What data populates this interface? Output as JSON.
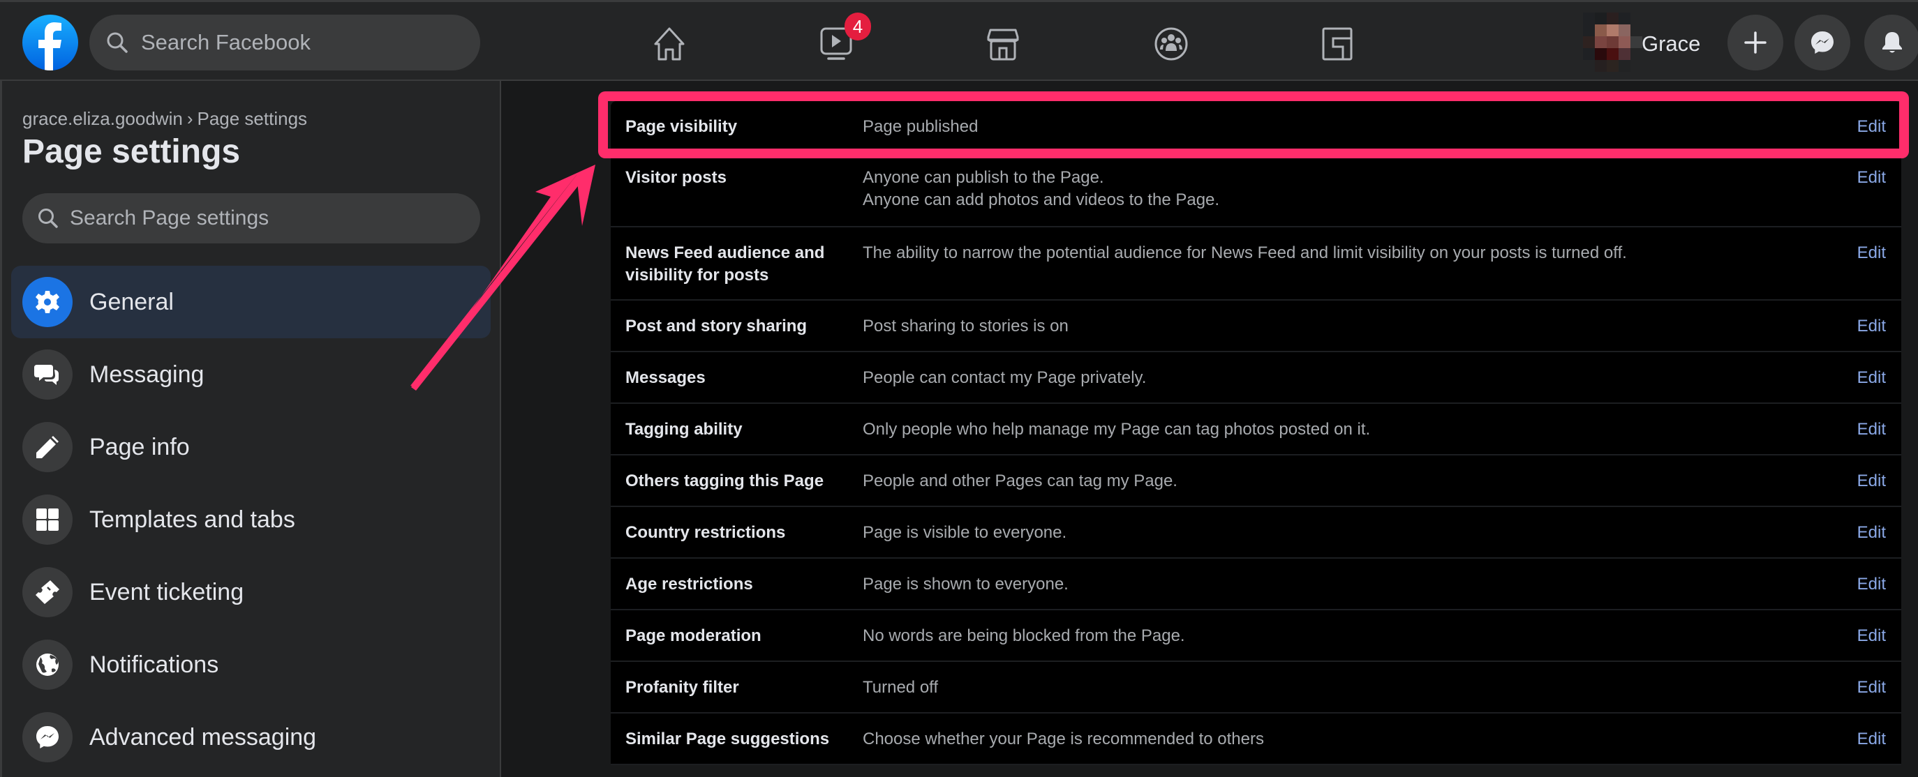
{
  "header": {
    "search_placeholder": "Search Facebook",
    "nav": [
      {
        "name": "home",
        "icon": "home-icon"
      },
      {
        "name": "watch",
        "icon": "video-icon",
        "badge": "4"
      },
      {
        "name": "marketplace",
        "icon": "marketplace-icon"
      },
      {
        "name": "groups",
        "icon": "groups-icon"
      },
      {
        "name": "gaming",
        "icon": "gaming-icon"
      }
    ],
    "user_name": "Grace",
    "actions": [
      {
        "name": "create",
        "icon": "plus-icon"
      },
      {
        "name": "messenger",
        "icon": "messenger-icon"
      },
      {
        "name": "notifications",
        "icon": "bell-icon"
      }
    ]
  },
  "sidebar": {
    "breadcrumb": {
      "parent": "grace.eliza.goodwin",
      "separator": "›",
      "current": "Page settings"
    },
    "title": "Page settings",
    "search_placeholder": "Search Page settings",
    "items": [
      {
        "label": "General",
        "icon": "gear-icon",
        "active": true
      },
      {
        "label": "Messaging",
        "icon": "chat-bubbles-icon"
      },
      {
        "label": "Page info",
        "icon": "pencil-icon"
      },
      {
        "label": "Templates and tabs",
        "icon": "grid-icon"
      },
      {
        "label": "Event ticketing",
        "icon": "ticket-icon"
      },
      {
        "label": "Notifications",
        "icon": "globe-icon"
      },
      {
        "label": "Advanced messaging",
        "icon": "messenger-icon"
      }
    ]
  },
  "settings": {
    "edit_label": "Edit",
    "rows": [
      {
        "label": "Page visibility",
        "desc": [
          "Page published"
        ]
      },
      {
        "label": "Visitor posts",
        "desc": [
          "Anyone can publish to the Page.",
          "Anyone can add photos and videos to the Page."
        ]
      },
      {
        "label": "News Feed audience and visibility for posts",
        "desc": [
          "The ability to narrow the potential audience for News Feed and limit visibility on your posts is turned off."
        ]
      },
      {
        "label": "Post and story sharing",
        "desc": [
          "Post sharing to stories is on"
        ]
      },
      {
        "label": "Messages",
        "desc": [
          "People can contact my Page privately."
        ]
      },
      {
        "label": "Tagging ability",
        "desc": [
          "Only people who help manage my Page can tag photos posted on it."
        ]
      },
      {
        "label": "Others tagging this Page",
        "desc": [
          "People and other Pages can tag my Page."
        ]
      },
      {
        "label": "Country restrictions",
        "desc": [
          "Page is visible to everyone."
        ]
      },
      {
        "label": "Age restrictions",
        "desc": [
          "Page is shown to everyone."
        ]
      },
      {
        "label": "Page moderation",
        "desc": [
          "No words are being blocked from the Page."
        ]
      },
      {
        "label": "Profanity filter",
        "desc": [
          "Turned off"
        ]
      },
      {
        "label": "Similar Page suggestions",
        "desc": [
          "Choose whether your Page is recommended to others"
        ]
      }
    ]
  },
  "annotation": {
    "highlighted_row": "Page visibility",
    "color": "#ff2d6b"
  }
}
